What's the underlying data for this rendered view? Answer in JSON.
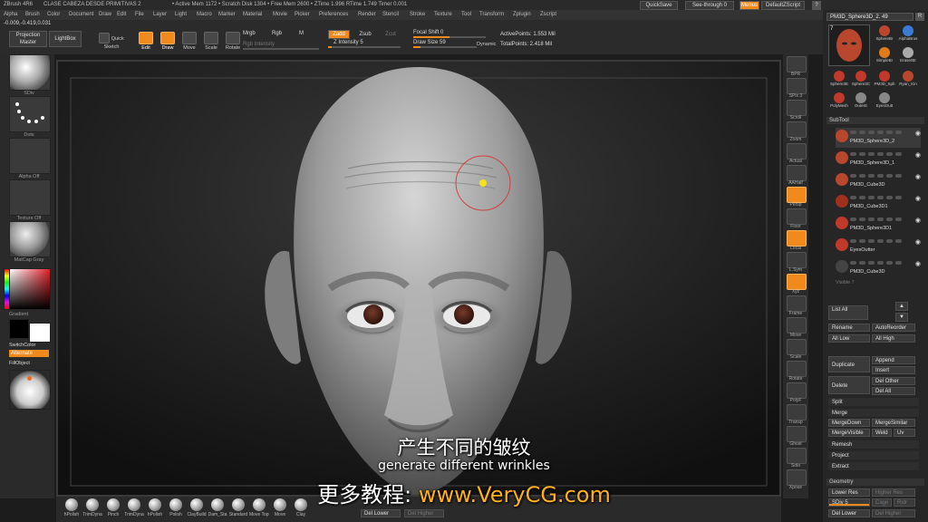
{
  "titlebar": {
    "app": "ZBrush 4R6",
    "doc": "CLASE CABEZA DESDE PRIMITIVAS 2",
    "stats": "• Active Mem 1172 • Scratch Disk 1304 • Free Mem 2600 • ZTime 1.996 RTime 1.749 Timer 0.001",
    "quicksave": "QuickSave",
    "seethrough": "See-through",
    "seethrough_value": "0",
    "menus_btn": "Menus",
    "script_btn": "DefaultZScript"
  },
  "menus": [
    "Alpha",
    "Brush",
    "Color",
    "Document",
    "Draw",
    "Edit",
    "File",
    "Layer",
    "Light",
    "Macro",
    "Marker",
    "Material",
    "Movie",
    "Picker",
    "Preferences",
    "Render",
    "Stencil",
    "Stroke",
    "Texture",
    "Tool",
    "Transform",
    "Zplugin",
    "Zscript"
  ],
  "coords": "-0.009,-0.419,0.031",
  "toolbar": {
    "projection_master": "Projection Master",
    "lightbox": "LightBox",
    "quick_sketch": "Quick Sketch",
    "tools": [
      {
        "label": "Edit",
        "on": true
      },
      {
        "label": "Draw",
        "on": true
      },
      {
        "label": "Move",
        "on": false
      },
      {
        "label": "Scale",
        "on": false
      },
      {
        "label": "Rotate",
        "on": false
      }
    ],
    "mrgb": "Mrgb",
    "rgb": "Rgb",
    "m": "M",
    "rgb_intensity": "Rgb Intensity",
    "zadd": "Zadd",
    "zsub": "Zsub",
    "zcut": "Zcut",
    "z_intensity_label": "Z Intensity",
    "z_intensity_value": "5",
    "focal_shift_label": "Focal Shift",
    "focal_shift_value": "0",
    "draw_size_label": "Draw Size",
    "draw_size_value": "59",
    "dynamic": "Dynamic",
    "active_points": "ActivePoints: 1.553 Mil",
    "total_points": "TotalPoints: 2.418 Mil"
  },
  "leftshelf": {
    "labels": [
      "SDiv",
      "Dots",
      "Alpha Off",
      "Texture Off",
      "MatCap Gray"
    ],
    "gradient": "Gradient",
    "switchcolor": "SwitchColor",
    "alternate": "Alternate",
    "fillobject": "FillObject"
  },
  "rightshelf": {
    "buttons": [
      "BPR",
      "SPix 3",
      "Scroll",
      "Zoom",
      "Actual",
      "AAHalf",
      "Persp",
      "Floor",
      "Local",
      "L.Sym",
      "Xyz",
      "Frame",
      "Move",
      "Scale",
      "Rotate",
      "PolyF",
      "Transp",
      "Ghost",
      "Solo",
      "Xpose"
    ]
  },
  "tray": {
    "tool_name": "PM3D_Sphere3D_2. 49",
    "r_btn": "R",
    "tool_count": "7",
    "thumbs": [
      "SphereBr",
      "AlphaBrus",
      "SimpleBr",
      "EraserBr",
      "Sphere3E",
      "Sphere3C",
      "PM3D_Sph",
      "Ryan_Kin",
      "PolyMesh",
      "OuterE",
      "EyesOutt"
    ],
    "subtool_head": "SubTool",
    "subtools": [
      {
        "name": "PM3D_Sphere3D_2",
        "color": "#b8472e"
      },
      {
        "name": "PM3D_Sphere3D_1",
        "color": "#b8472e"
      },
      {
        "name": "PM3D_Cube3D",
        "color": "#b8472e"
      },
      {
        "name": "PM3D_Cube3D1",
        "color": "#a0301e"
      },
      {
        "name": "PM3D_Sphere3D1",
        "color": "#c0392b"
      },
      {
        "name": "EyesOutter",
        "color": "#c0392b"
      },
      {
        "name": "PM3D_Cube3D",
        "color": "#444"
      }
    ],
    "visible_label": "Visible 7",
    "list_all": "List All",
    "rename": "Rename",
    "autoreorder": "AutoReorder",
    "all_low": "All Low",
    "all_high": "All High",
    "duplicate": "Duplicate",
    "append": "Append",
    "insert": "Insert",
    "delete": "Delete",
    "del_other": "Del Other",
    "del_all": "Del All",
    "split": "Split",
    "merge": "Merge",
    "mergedown": "MergeDown",
    "mergesimilar": "MergeSimilar",
    "mergevisible": "MergeVisible",
    "weld": "Weld",
    "uv": "Uv",
    "remesh": "Remesh",
    "project": "Project",
    "extract": "Extract",
    "geometry_head": "Geometry",
    "lower_res": "Lower Res",
    "higher_res": "Higher Res",
    "sdiv": "SDiv 5",
    "cage": "Cage",
    "rstr": "Rstr",
    "del_lower": "Del Lower",
    "del_higher": "Del Higher"
  },
  "brushes": [
    "hPolish",
    "TrimDyna",
    "Pinch",
    "TrimDyna",
    "hPolish",
    "Polish",
    "ClayBuild",
    "Dam_Sta",
    "Standard",
    "Move Topo",
    "Move",
    "Clay"
  ],
  "bottom": {
    "del_lower": "Del Lower",
    "del_higher": "Del Higher"
  },
  "subtitle": {
    "chinese": "产生不同的皱纹",
    "english": "generate different wrinkles",
    "ad_prefix": "更多教程: ",
    "ad_url": "www.VeryCG.com"
  },
  "colors": {
    "accent": "#f08a1c",
    "ad_url": "#ffb019"
  }
}
